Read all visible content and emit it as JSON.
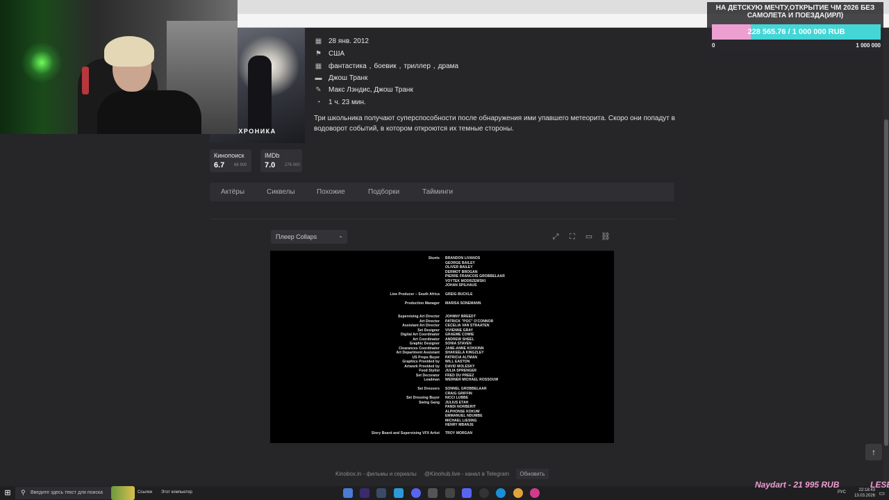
{
  "movie": {
    "poster_title": "ХРОНИКА",
    "date": "28 янв. 2012",
    "country": "США",
    "genres": [
      "фантастика",
      "боевик",
      "триллер",
      "драма"
    ],
    "director": "Джош Транк",
    "writers": "Макс Лэндис, Джош Транк",
    "duration": "1 ч. 23 мин.",
    "description": "Три школьника получают суперспособности после обнаружения ими упавшего метеорита. Скоро они попадут в водоворот событий, в котором откроются их темные стороны.",
    "ratings": [
      {
        "name": "Кинопоиск",
        "value": "6.7",
        "count": "86 900"
      },
      {
        "name": "IMDb",
        "value": "7.0",
        "count": "276 000"
      }
    ]
  },
  "tabs": [
    "Актёры",
    "Сиквелы",
    "Похожие",
    "Подборки",
    "Тайминги"
  ],
  "player": {
    "select_label": "Плеер Collaps",
    "icons": [
      "expand-icon",
      "fullscreen-icon",
      "comment-icon",
      "link-icon"
    ]
  },
  "credits": [
    {
      "role": "Stunts",
      "names": [
        "BRANDON LIVANOS",
        "GEORGE BAILEY",
        "OLIVER BAILEY",
        "DERMOT BROGAN",
        "PIERRE FRANCOIS GROBBELAAR",
        "VOYTEK MODRZEWSKI",
        "JOHAN SPILHAUS"
      ]
    },
    {
      "role": "Line Producer – South Africa",
      "names": [
        "GREIG BUCKLE"
      ]
    },
    {
      "role": "Production Manager",
      "names": [
        "MARISA SONEMANN"
      ]
    },
    {
      "role": "Supervising Art Director",
      "names": [
        "JOHNNY BREEDT"
      ]
    },
    {
      "role": "Art Director",
      "names": [
        "PATRICK \"POC\" O'CONNOR"
      ]
    },
    {
      "role": "Assistant Art Director",
      "names": [
        "CECELIA VAN STRAATEN"
      ]
    },
    {
      "role": "Set Designer",
      "names": [
        "VIVIENNE GRAY"
      ]
    },
    {
      "role": "Digital Art Coordinator",
      "names": [
        "GRAEME COWIE"
      ]
    },
    {
      "role": "Art Coordinator",
      "names": [
        "ANDREW SHEEL"
      ]
    },
    {
      "role": "Graphic Designer",
      "names": [
        "SONIA STAVEN"
      ]
    },
    {
      "role": "Clearances Coordinator",
      "names": [
        "JANE-ANNE KOKKINN"
      ]
    },
    {
      "role": "Art Department Assistant",
      "names": [
        "SHAKEELA KINGZLEY"
      ]
    },
    {
      "role": "US Props Buyer",
      "names": [
        "PATRICIA ALTMAN"
      ]
    },
    {
      "role": "Graphics Provided by",
      "names": [
        "WILL EASTON"
      ]
    },
    {
      "role": "Artwork Provided by",
      "names": [
        "DAVID MOLESKY"
      ]
    },
    {
      "role": "Food Stylist",
      "names": [
        "JULIA SPRENGER"
      ]
    },
    {
      "role": "Set Decorator",
      "names": [
        "FRED DU PREEZ"
      ]
    },
    {
      "role": "Leadman",
      "names": [
        "WERNER MICHAEL ROSSOUW"
      ]
    },
    {
      "role": "Set Dressers",
      "names": [
        "SONNEL GROBBELAAR",
        "CRAIG GRIFFIN"
      ]
    },
    {
      "role": "Set Dressing Buyer",
      "names": [
        "NICCI LUBBE"
      ]
    },
    {
      "role": "Swing Gang",
      "names": [
        "JULIUS ETAH",
        "PANDI NORBERIT",
        "ALPHONSE KOKUM",
        "EMMANUEL NDUMBE",
        "MICHAEL LIESING",
        "HENRY MBANJE"
      ]
    },
    {
      "role": "Story Board and Supervising VFX Artist",
      "names": [
        "TROY MORGAN"
      ]
    }
  ],
  "footer": {
    "site": "Kinobox.in - фильмы и сериалы",
    "telegram": "@Kinohub.live - канал в Telegram",
    "refresh": "Обновить"
  },
  "donation": {
    "title": "НА ДЕТСКУЮ МЕЧТУ,ОТКРЫТИЕ ЧМ 2026 БЕЗ САМОЛЕТА И ПОЕЗДА(ИРЛ)",
    "progress_text": "228 565.76 / 1 000 000 RUB",
    "progress_fraction": 0.2286,
    "min": "0",
    "max": "1 000 000",
    "colors": {
      "fill": "#ee9fd2",
      "track": "#44d6d6"
    }
  },
  "ticker": {
    "text": "Naydart - 21 995 RUB",
    "text2": "LESE"
  },
  "taskbar": {
    "search_placeholder": "Введите здесь текст для поиска",
    "links_label": "Ссылки",
    "computer_label": "Этот компьютер",
    "lang": "РУС",
    "time": "22:18:43",
    "date": "13.03.2026"
  }
}
